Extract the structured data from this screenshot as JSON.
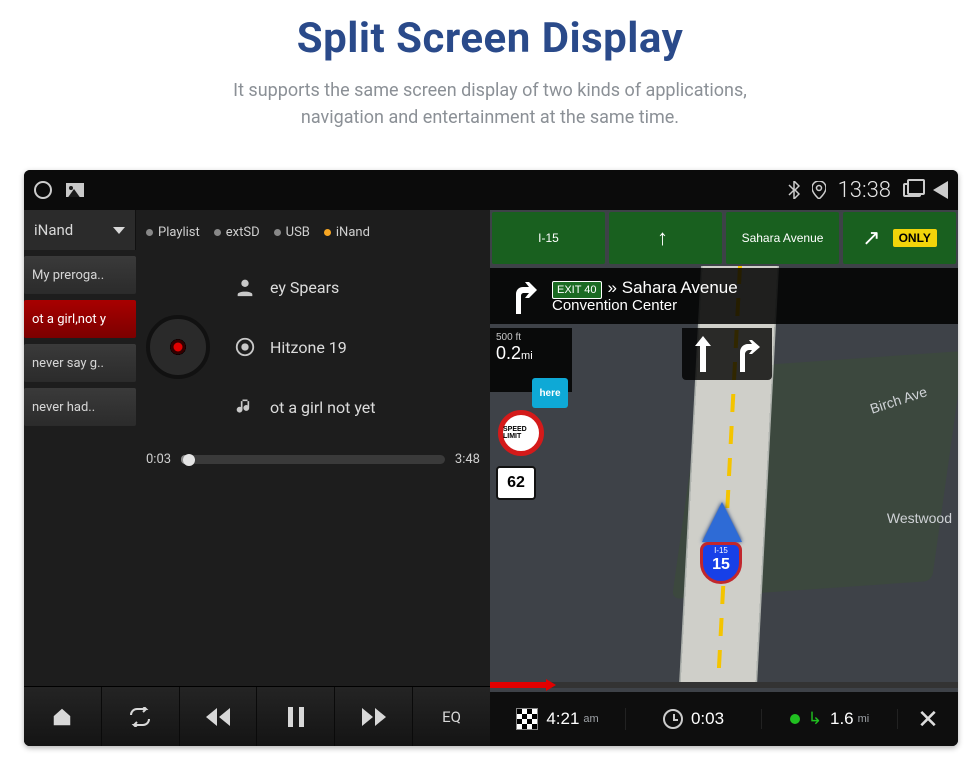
{
  "page": {
    "title": "Split Screen Display",
    "subtitle_l1": "It supports the same screen display of two kinds of applications,",
    "subtitle_l2": "navigation and entertainment at the same time."
  },
  "status": {
    "time": "13:38"
  },
  "music": {
    "source": "iNand",
    "tabs": {
      "playlist": "Playlist",
      "extsd": "extSD",
      "usb": "USB",
      "inand": "iNand"
    },
    "tracks": [
      "My preroga..",
      "ot a girl,not y",
      "never say g..",
      "never had.."
    ],
    "active_track_index": 1,
    "artist": "ey Spears",
    "album": "Hitzone 19",
    "song": "ot a girl not yet",
    "elapsed": "0:03",
    "duration": "3:48",
    "eq_label": "EQ"
  },
  "nav": {
    "overhead_i": "I-15",
    "overhead_street": "Sahara Avenue",
    "only": "ONLY",
    "exit_tag": "EXIT 40",
    "dest_line1": "» Sahara Avenue",
    "dest_line2": "Convention Center",
    "next_ft": "500 ft",
    "next_mi": "0.2",
    "next_unit": "mi",
    "route_shield": "62",
    "i15_label": "I-15",
    "i15_num": "15",
    "street_birch": "Birch Ave",
    "street_westwood": "Westwood",
    "speed_label": "SPEED LIMIT",
    "here": "here",
    "bottom": {
      "eta": "4:21",
      "eta_unit": "am",
      "trip_elapsed": "0:03",
      "remaining": "1.6",
      "remaining_unit": "mi"
    }
  }
}
